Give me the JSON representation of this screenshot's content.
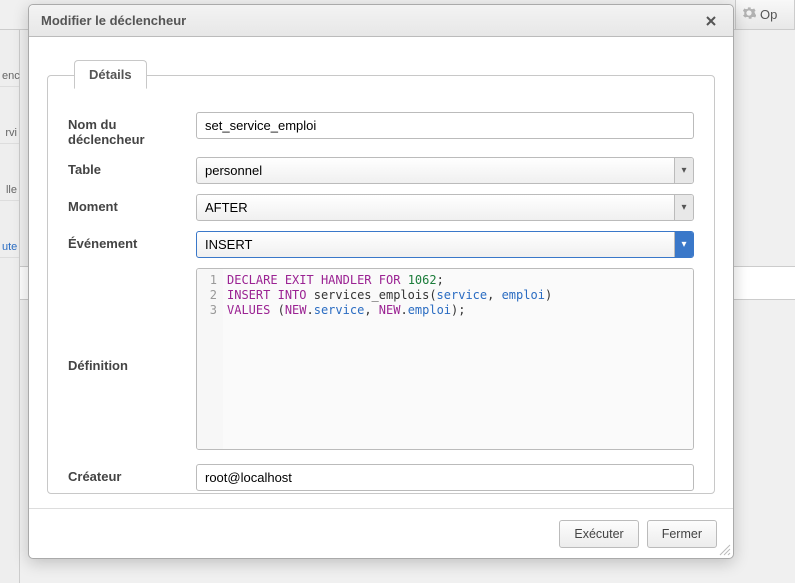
{
  "bg": {
    "right_label": "Op",
    "side": [
      "enc",
      "rvi",
      "lle",
      "ute"
    ]
  },
  "dialog": {
    "title": "Modifier le déclencheur",
    "legend": "Détails",
    "labels": {
      "name": "Nom du déclencheur",
      "table": "Table",
      "moment": "Moment",
      "event": "Événement",
      "definition": "Définition",
      "creator": "Créateur"
    },
    "fields": {
      "name": "set_service_emploi",
      "table": "personnel",
      "moment": "AFTER",
      "event": "INSERT",
      "creator": "root@localhost"
    },
    "code": {
      "lines": [
        "1",
        "2",
        "3"
      ],
      "tokens": [
        [
          {
            "t": "DECLARE",
            "c": "kw"
          },
          {
            "t": " "
          },
          {
            "t": "EXIT",
            "c": "kw"
          },
          {
            "t": " "
          },
          {
            "t": "HANDLER",
            "c": "kw"
          },
          {
            "t": " "
          },
          {
            "t": "FOR",
            "c": "kw"
          },
          {
            "t": " "
          },
          {
            "t": "1062",
            "c": "num"
          },
          {
            "t": ";"
          }
        ],
        [
          {
            "t": "INSERT",
            "c": "kw"
          },
          {
            "t": " "
          },
          {
            "t": "INTO",
            "c": "kw"
          },
          {
            "t": " services_emplois("
          },
          {
            "t": "service",
            "c": "fn"
          },
          {
            "t": ", "
          },
          {
            "t": "emploi",
            "c": "fn"
          },
          {
            "t": ")"
          }
        ],
        [
          {
            "t": "VALUES",
            "c": "kw"
          },
          {
            "t": " ("
          },
          {
            "t": "NEW",
            "c": "kw"
          },
          {
            "t": "."
          },
          {
            "t": "service",
            "c": "col"
          },
          {
            "t": ", "
          },
          {
            "t": "NEW",
            "c": "kw"
          },
          {
            "t": "."
          },
          {
            "t": "emploi",
            "c": "col"
          },
          {
            "t": ");"
          }
        ]
      ]
    },
    "buttons": {
      "execute": "Exécuter",
      "close": "Fermer"
    }
  }
}
